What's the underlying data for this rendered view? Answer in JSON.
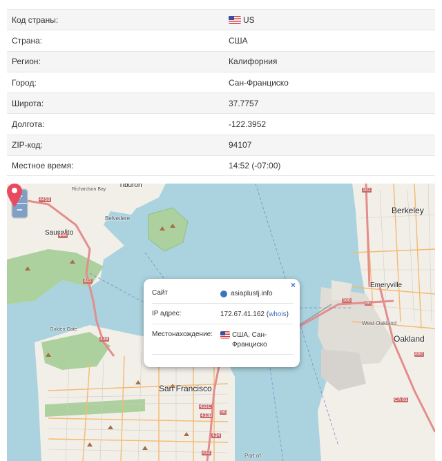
{
  "info": {
    "rows": [
      {
        "label": "Код страны:",
        "value": "US",
        "flag": true
      },
      {
        "label": "Страна:",
        "value": "США",
        "flag": false
      },
      {
        "label": "Регион:",
        "value": "Калифорния",
        "flag": false
      },
      {
        "label": "Город:",
        "value": "Сан-Франциско",
        "flag": false
      },
      {
        "label": "Широта:",
        "value": "37.7757",
        "flag": false
      },
      {
        "label": "Долгота:",
        "value": "-122.3952",
        "flag": false
      },
      {
        "label": "ZIP-код:",
        "value": "94107",
        "flag": false
      },
      {
        "label": "Местное время:",
        "value": "14:52 (-07:00)",
        "flag": false
      }
    ]
  },
  "map": {
    "zoom_in": "+",
    "zoom_out": "−",
    "popup": {
      "close": "×",
      "site_label": "Сайт",
      "site_value": "asiaplustj.info",
      "ip_label": "IP адрес:",
      "ip_value": "172.67.41.162 (",
      "ip_link": "whois",
      "ip_close": ")",
      "location_label": "Местонахождение:",
      "location_value": "США, Сан-Франциско"
    },
    "labels": {
      "san_francisco": "San Francisco",
      "sausalito": "Sausalito",
      "belvedere": "Belvedere",
      "tiburon": "Tiburon",
      "berkeley": "Berkeley",
      "emeryville": "Emeryville",
      "oakland": "Oakland",
      "west_oakland": "West Oakland",
      "richardson_bay": "Richardson Bay",
      "golden_gate": "Golden Gate",
      "port_of": "Port of",
      "route_101": "101",
      "route_80": "80",
      "route_580": "580",
      "route_880": "880",
      "route_ca61": "CA 61",
      "route_442": "442",
      "route_444": "444",
      "route_4458": "4458",
      "route_438": "438",
      "route_433c": "433C",
      "route_433b": "433B",
      "route_432": "432",
      "route_434": "434",
      "route_56": "56"
    },
    "colors": {
      "water": "#aad3df",
      "land": "#f2efe9",
      "park": "#add19e",
      "marker": "#e84a5f"
    }
  }
}
